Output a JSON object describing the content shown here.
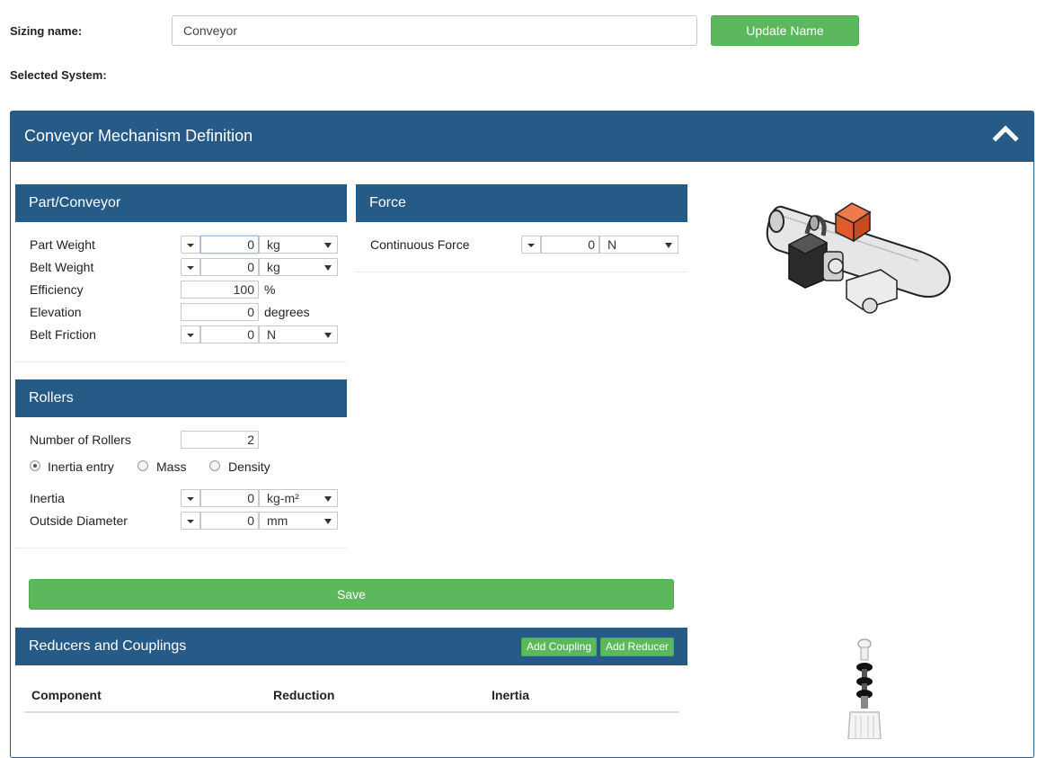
{
  "header": {
    "sizing_name_label": "Sizing name:",
    "sizing_name_value": "Conveyor",
    "update_name_button": "Update Name",
    "selected_system_label": "Selected System:"
  },
  "main_panel": {
    "title": "Conveyor Mechanism Definition"
  },
  "part_conveyor": {
    "title": "Part/Conveyor",
    "rows": [
      {
        "label": "Part Weight",
        "value": "0",
        "unit": "kg"
      },
      {
        "label": "Belt Weight",
        "value": "0",
        "unit": "kg"
      },
      {
        "label": "Efficiency",
        "value": "100",
        "unit": "%"
      },
      {
        "label": "Elevation",
        "value": "0",
        "unit": "degrees"
      },
      {
        "label": "Belt Friction",
        "value": "0",
        "unit": "N"
      }
    ]
  },
  "force": {
    "title": "Force",
    "rows": [
      {
        "label": "Continuous Force",
        "value": "0",
        "unit": "N"
      }
    ]
  },
  "rollers": {
    "title": "Rollers",
    "number_label": "Number of Rollers",
    "number_value": "2",
    "radio_options": [
      "Inertia entry",
      "Mass",
      "Density"
    ],
    "radio_selected": "Inertia entry",
    "rows": [
      {
        "label": "Inertia",
        "value": "0",
        "unit": "kg-m²"
      },
      {
        "label": "Outside Diameter",
        "value": "0",
        "unit": "mm"
      }
    ]
  },
  "save_button": "Save",
  "reducers": {
    "title": "Reducers and Couplings",
    "add_coupling": "Add Coupling",
    "add_reducer": "Add Reducer",
    "columns": [
      "Component",
      "Reduction",
      "Inertia"
    ]
  },
  "colors": {
    "header_blue": "#265a87",
    "button_green": "#5cb85c",
    "box_orange": "#e05a2b"
  }
}
